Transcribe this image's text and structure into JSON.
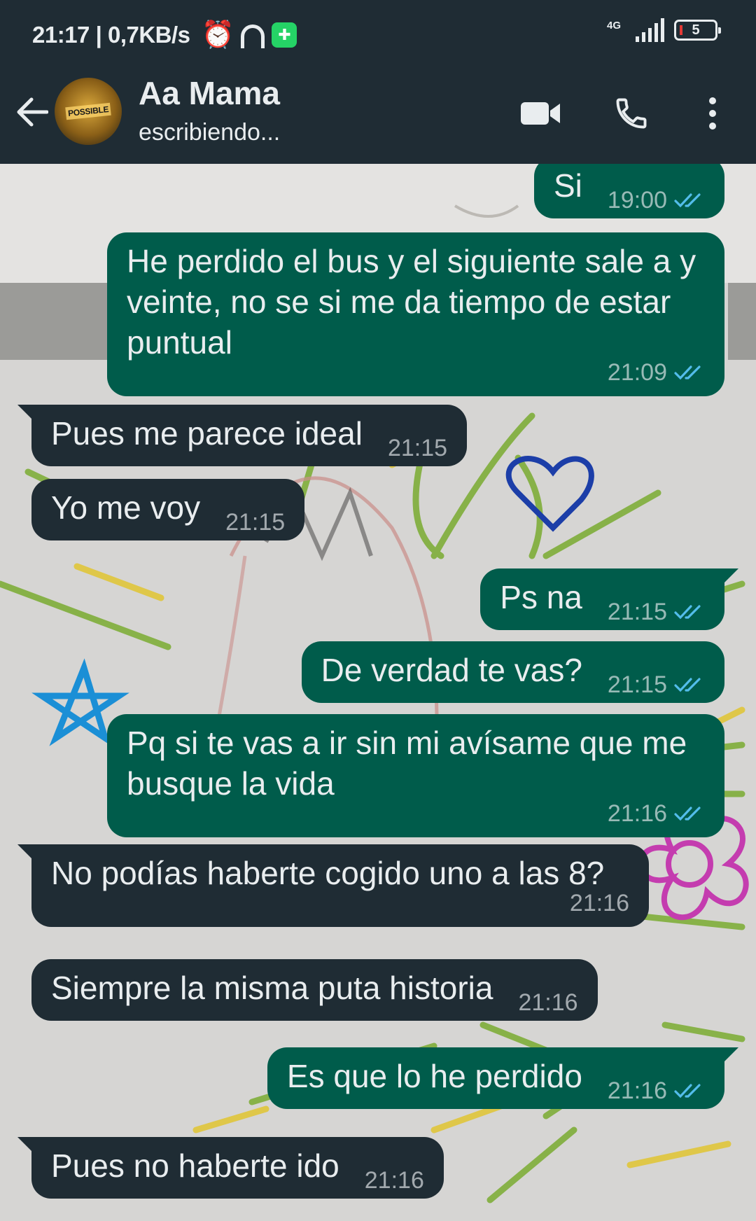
{
  "status_bar": {
    "time_speed": "21:17 | 0,7KB/s",
    "network": "4G",
    "battery": "5"
  },
  "header": {
    "contact_name": "Aa Mama",
    "contact_status": "escribiendo...",
    "avatar_text": "POSSIBLE"
  },
  "messages": [
    {
      "dir": "out",
      "text": "Si",
      "time": "19:00",
      "read": true
    },
    {
      "dir": "out",
      "text": "He perdido el bus y el siguiente sale a y veinte, no se si me da tiempo de estar puntual",
      "time": "21:09",
      "read": true
    },
    {
      "dir": "in",
      "text": "Pues me parece ideal",
      "time": "21:15"
    },
    {
      "dir": "in",
      "text": "Yo me voy",
      "time": "21:15"
    },
    {
      "dir": "out",
      "text": "Ps na",
      "time": "21:15",
      "read": true
    },
    {
      "dir": "out",
      "text": "De verdad te vas?",
      "time": "21:15",
      "read": true
    },
    {
      "dir": "out",
      "text": "Pq si te vas a ir sin mi avísame que me busque la vida",
      "time": "21:16",
      "read": true
    },
    {
      "dir": "in",
      "text": "No podías haberte cogido uno a las 8?",
      "time": "21:16"
    },
    {
      "dir": "in",
      "text": "Siempre la misma puta historia",
      "time": "21:16"
    },
    {
      "dir": "out",
      "text": "Es que lo he perdido",
      "time": "21:16",
      "read": true
    },
    {
      "dir": "in",
      "text": "Pues no haberte ido",
      "time": "21:16"
    }
  ],
  "colors": {
    "header_bg": "#1f2c34",
    "outgoing_bubble": "#005c4b",
    "incoming_bubble": "#1f2c34",
    "read_ticks": "#53bdeb"
  }
}
